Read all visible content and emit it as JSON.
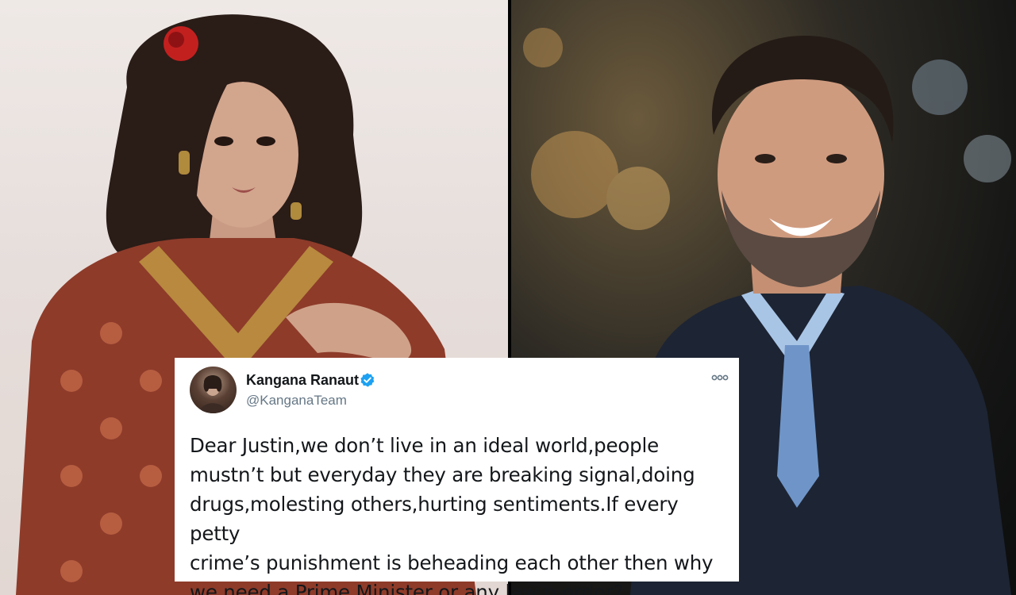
{
  "left_photo": {
    "description_icon": "woman-portrait-photo"
  },
  "right_photo": {
    "description_icon": "man-speaking-photo"
  },
  "tweet": {
    "author_name": "Kangana Ranaut",
    "handle": "@KanganaTeam",
    "verified": true,
    "text_lines": [
      "Dear Justin,we don’t live in an ideal world,people",
      "mustn’t but everyday they are breaking signal,doing",
      "drugs,molesting others,hurting sentiments.If every petty",
      "crime’s punishment is beheading each other then why",
      "we need a Prime Minister or any law n order?"
    ],
    "colors": {
      "verified_badge": "#1da1f2",
      "name": "#14171a",
      "handle": "#657786"
    }
  }
}
